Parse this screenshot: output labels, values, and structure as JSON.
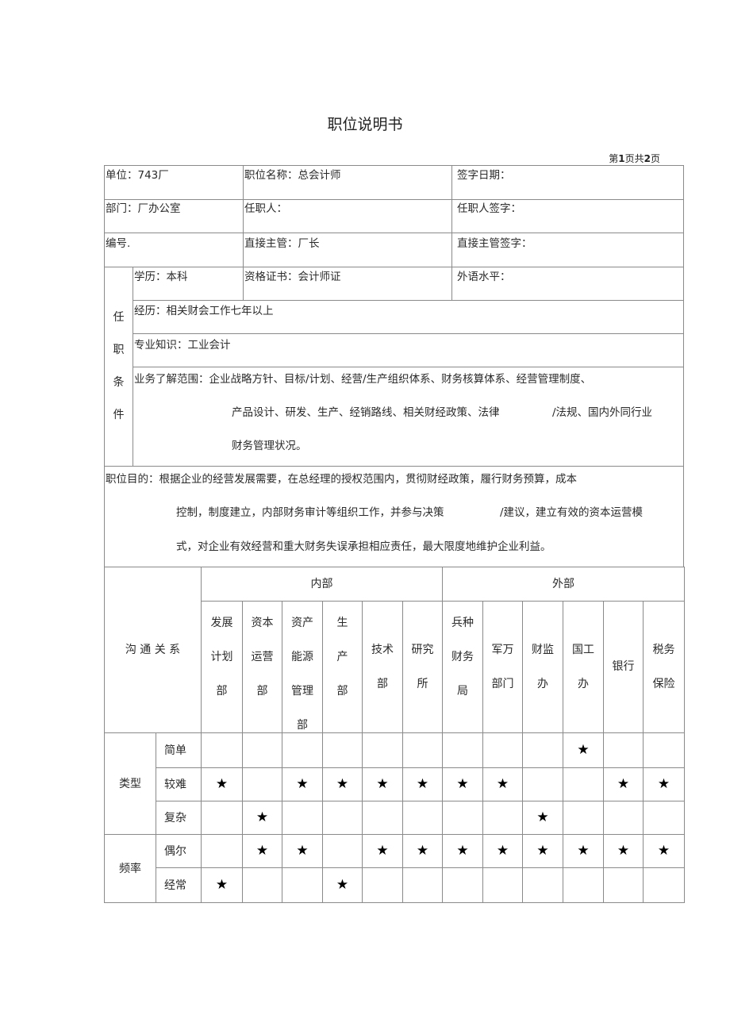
{
  "document": {
    "title": "职位说明书",
    "page_info": {
      "prefix": "第",
      "current": "1",
      "middle": "页共",
      "total": "2",
      "suffix": "页"
    }
  },
  "basic_info": {
    "unit": "单位：743厂",
    "position_name": "职位名称：总会计师",
    "sign_date": "签字日期：",
    "department": "部门：厂办公室",
    "incumbent": "任职人：",
    "incumbent_sign": "任职人签字：",
    "number": "编号.",
    "supervisor": "直接主管：厂长",
    "supervisor_sign": "直接主管签字："
  },
  "qualifications": {
    "label_chars": [
      "任",
      "职",
      "条",
      "件"
    ],
    "education": "学历：本科",
    "certificate": "资格证书：会计师证",
    "foreign_language": "外语水平：",
    "experience": "经历：相关财会工作七年以上",
    "knowledge": "专业知识：工业会计",
    "business_scope_line1": "业务了解范围：企业战略方针、目标/计划、经营/生产组织体系、财务核算体系、经营管理制度、",
    "business_scope_line2a": "产品设计、研发、生产、经销路线、相关财经政策、法律",
    "business_scope_line2b": "/法规、国内外同行业",
    "business_scope_line3": "财务管理状况。"
  },
  "purpose": {
    "line1": "职位目的：根据企业的经营发展需要，在总经理的授权范围内，贯彻财经政策，履行财务预算，成本",
    "line2a": "控制，制度建立，内部财务审计等组织工作，并参与决策",
    "line2b": "/建议，建立有效的资本运营模",
    "line3": "式，对企业有效经营和重大财务失误承担相应责任，最大限度地维护企业利益。"
  },
  "communication": {
    "label": "沟 通 关 系",
    "internal_label": "内部",
    "external_label": "外部",
    "columns": [
      {
        "lines": [
          "发展",
          "计划",
          "部"
        ]
      },
      {
        "lines": [
          "资本",
          "运营",
          "部"
        ]
      },
      {
        "lines": [
          "资产",
          "能源",
          "管理",
          "部"
        ]
      },
      {
        "lines": [
          "生",
          "产",
          "部"
        ]
      },
      {
        "lines": [
          "技术",
          "部"
        ]
      },
      {
        "lines": [
          "研究",
          "所"
        ]
      },
      {
        "lines": [
          "兵种",
          "财务",
          "局"
        ]
      },
      {
        "lines": [
          "军万",
          "部门"
        ]
      },
      {
        "lines": [
          "财监",
          "办"
        ]
      },
      {
        "lines": [
          "国工",
          "办"
        ]
      },
      {
        "lines": [
          "银行"
        ]
      },
      {
        "lines": [
          "税务",
          "保险"
        ]
      }
    ],
    "mark_symbol": "★",
    "groups": [
      {
        "label": "类型",
        "rows": [
          {
            "label": "简单",
            "marks": [
              0,
              0,
              0,
              0,
              0,
              0,
              0,
              0,
              0,
              1,
              0,
              0
            ]
          },
          {
            "label": "较难",
            "marks": [
              1,
              0,
              1,
              1,
              1,
              1,
              1,
              1,
              0,
              0,
              1,
              1
            ]
          },
          {
            "label": "复杂",
            "marks": [
              0,
              1,
              0,
              0,
              0,
              0,
              0,
              0,
              1,
              0,
              0,
              0
            ]
          }
        ]
      },
      {
        "label": "频率",
        "rows": [
          {
            "label": "偶尔",
            "marks": [
              0,
              1,
              1,
              0,
              1,
              1,
              1,
              1,
              1,
              1,
              1,
              1
            ]
          },
          {
            "label": "经常",
            "marks": [
              1,
              0,
              0,
              1,
              0,
              0,
              0,
              0,
              0,
              0,
              0,
              0
            ]
          }
        ]
      }
    ]
  }
}
